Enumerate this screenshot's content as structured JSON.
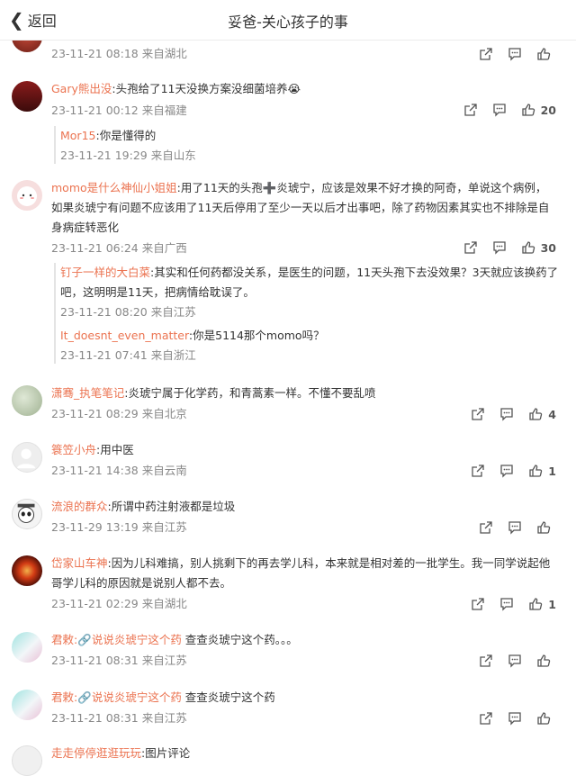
{
  "header": {
    "back_label": "返回",
    "title": "妥爸-关心孩子的事"
  },
  "comments": [
    {
      "id": "c0",
      "meta": "23-11-21 08:18 来自湖北",
      "like_count": ""
    },
    {
      "id": "c1",
      "user": "Gary熊出没",
      "text": ":头孢给了11天没换方案没细菌培养😭",
      "meta": "23-11-21 00:12 来自福建",
      "like_count": "20",
      "replies": [
        {
          "user": "Mor15",
          "text": ":你是懂得的",
          "meta": "23-11-21 19:29 来自山东"
        }
      ]
    },
    {
      "id": "c2",
      "user": "momo是什么神仙小姐姐",
      "text": ":用了11天的头孢➕炎琥宁，应该是效果不好才换的阿奇，单说这个病例，如果炎琥宁有问题不应该用了11天后停用了至少一天以后才出事吧，除了药物因素其实也不排除是自身病症转恶化",
      "meta": "23-11-21 06:24 来自广西",
      "like_count": "30",
      "replies": [
        {
          "user": "钉子一样的大白菜",
          "text": ":其实和任何药都没关系，是医生的问题，11天头孢下去没效果？3天就应该换药了吧，这明明是11天，把病情给耽误了。",
          "meta": "23-11-21 08:20 来自江苏"
        },
        {
          "user": "It_doesnt_even_matter",
          "text": ":你是5114那个momo吗？",
          "meta": "23-11-21 07:41 来自浙江"
        }
      ]
    },
    {
      "id": "c3",
      "user": "潇骞_执笔笔记",
      "text": ":炎琥宁属于化学药，和青蒿素一样。不懂不要乱喷",
      "meta": "23-11-21 08:29 来自北京",
      "like_count": "4"
    },
    {
      "id": "c4",
      "user": "簑笠小舟",
      "text": ":用中医",
      "meta": "23-11-21 14:38 来自云南",
      "like_count": "1"
    },
    {
      "id": "c5",
      "user": "流浪的群众",
      "text": ":所谓中药注射液都是垃圾",
      "meta": "23-11-29 13:19 来自江苏",
      "like_count": ""
    },
    {
      "id": "c6",
      "user": "岱家山车神",
      "text": ":因为儿科难搞，别人挑剩下的再去学儿科，本来就是相对差的一批学生。我一同学说起他哥学儿科的原因就是说别人都不去。",
      "meta": "23-11-21 02:29 来自湖北",
      "like_count": "1"
    },
    {
      "id": "c7",
      "user": "君敕",
      "link_text": "说说炎琥宁这个药",
      "text": " 查查炎琥宁这个药。。。",
      "meta": "23-11-21 08:31 来自江苏",
      "like_count": ""
    },
    {
      "id": "c8",
      "user": "君敕",
      "link_text": "说说炎琥宁这个药",
      "text": " 查查炎琥宁这个药",
      "meta": "23-11-21 08:31 来自江苏",
      "like_count": ""
    },
    {
      "id": "c9",
      "user": "走走停停逛逛玩玩",
      "text": ":图片评论"
    }
  ],
  "colors": {
    "username": "#eb7350",
    "meta": "#888888",
    "text": "#333333"
  },
  "icons": {
    "share": "share-icon",
    "comment": "comment-icon",
    "like": "thumbs-up-icon",
    "link": "link-icon"
  }
}
